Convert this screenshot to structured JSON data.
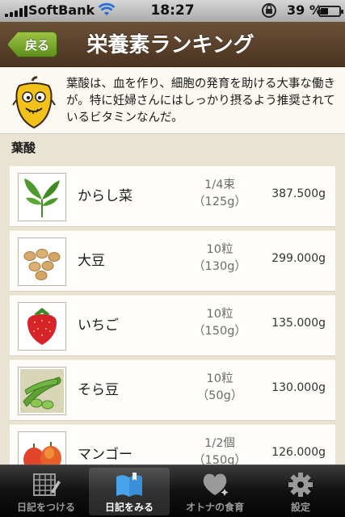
{
  "status": {
    "carrier": "SoftBank",
    "time": "18:27",
    "battery": "39 %",
    "battery_level": 0.39
  },
  "nav": {
    "back_label": "戻る",
    "title": "栄養素ランキング"
  },
  "info": {
    "text": "葉酸は、血を作り、細胞の発育を助ける大事な働きが。特に妊婦さんにはしっかり摂るよう推奨されているビタミンなんだ。"
  },
  "section_title": "葉酸",
  "items": [
    {
      "name": "からし菜",
      "qty1": "1/4束",
      "qty2": "（125g）",
      "amount": "387.500g",
      "icon": "mustard-greens-icon"
    },
    {
      "name": "大豆",
      "qty1": "10粒",
      "qty2": "（130g）",
      "amount": "299.000g",
      "icon": "soybeans-icon"
    },
    {
      "name": "いちご",
      "qty1": "10粒",
      "qty2": "（150g）",
      "amount": "135.000g",
      "icon": "strawberry-icon"
    },
    {
      "name": "そら豆",
      "qty1": "10粒",
      "qty2": "（50g）",
      "amount": "130.000g",
      "icon": "broad-beans-icon"
    },
    {
      "name": "マンゴー",
      "qty1": "1/2個",
      "qty2": "（150g）",
      "amount": "126.000g",
      "icon": "mango-icon"
    }
  ],
  "tabs": [
    {
      "label": "日記をつける",
      "icon": "diary-write-icon"
    },
    {
      "label": "日記をみる",
      "icon": "open-book-icon"
    },
    {
      "label": "オトナの食育",
      "icon": "heart-icon"
    },
    {
      "label": "設定",
      "icon": "gear-icon"
    }
  ],
  "active_tab": 1
}
